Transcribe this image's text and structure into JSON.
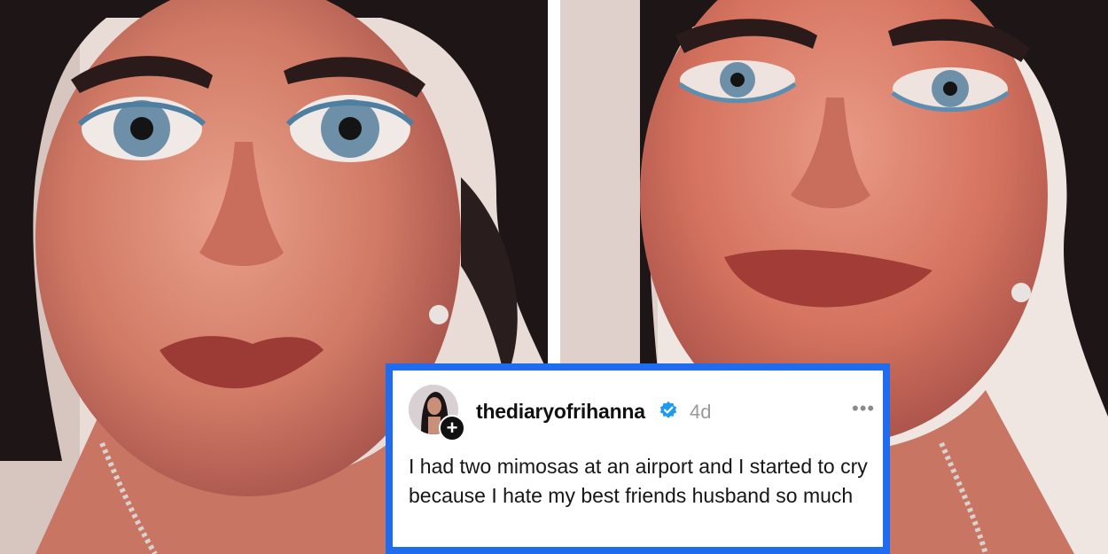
{
  "post": {
    "username": "thediaryofrihanna",
    "time": "4d",
    "more": "•••",
    "follow": "+",
    "text": "I had two mimosas at an airport and I started to cry because I hate my best friends husband so much"
  },
  "colors": {
    "card_border": "#1f6cf0",
    "verified": "#1d9bf0"
  },
  "icons": {
    "verified": "verified-badge-icon",
    "more": "more-options-icon",
    "follow": "plus-icon"
  }
}
